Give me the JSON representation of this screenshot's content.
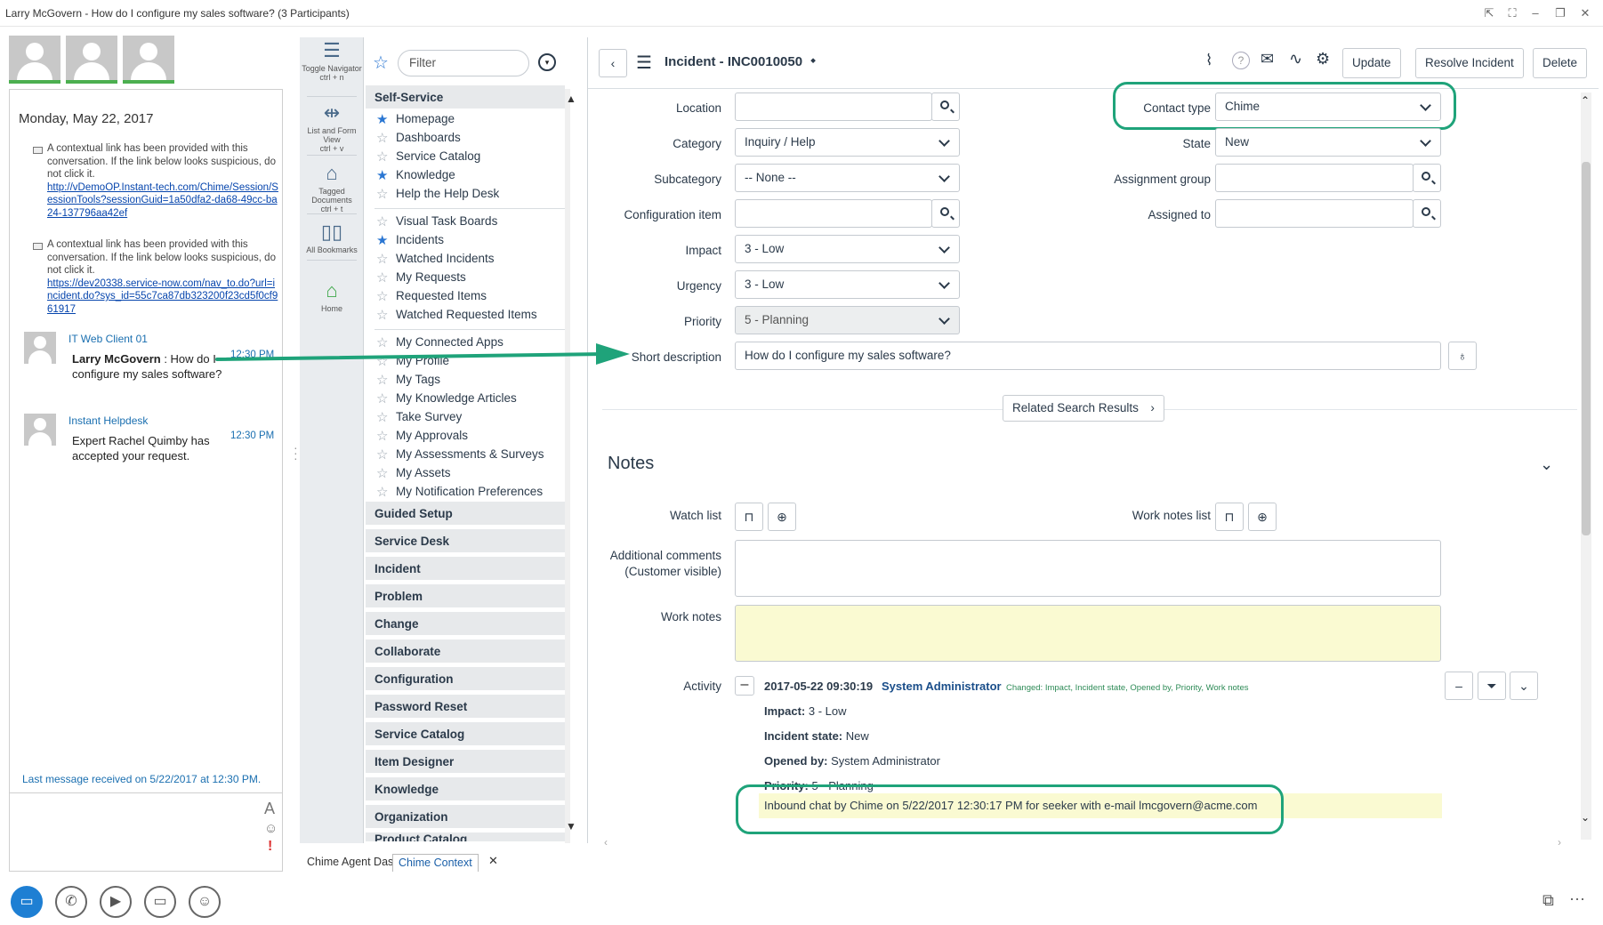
{
  "window": {
    "title": "Larry McGovern - How do I configure my sales software? (3 Participants)"
  },
  "chat": {
    "date": "Monday, May 22, 2017",
    "sys1_text": "A contextual link has been provided with this conversation. If the link below looks suspicious, do not click it.",
    "sys1_link": "http://vDemoOP.Instant-tech.com/Chime/Session/SessionTools?sessionGuid=1a50dfa2-da68-49cc-ba24-137796aa42ef",
    "sys2_text": "A contextual link has been provided with this conversation. If the link below looks suspicious, do not click it.",
    "sys2_link": "https://dev20338.service-now.com/nav_to.do?url=incident.do?sys_id=55c7ca87db323200f23cd5f0cf961917",
    "msg1_sender": "IT Web Client 01",
    "msg1_time": "12:30 PM",
    "msg1_name": "Larry McGovern",
    "msg1_text": " : How do I configure my sales software?",
    "msg2_sender": "Instant Helpdesk",
    "msg2_time": "12:30 PM",
    "msg2_text": "Expert Rachel Quimby has accepted your request.",
    "last_message": "Last message received on 5/22/2017 at 12:30 PM."
  },
  "navstrip": {
    "toggle": "Toggle Navigator",
    "toggle_key": "ctrl + n",
    "listform": "List and Form View",
    "listform_key": "ctrl + v",
    "tagged": "Tagged Documents",
    "tagged_key": "ctrl + t",
    "bookmarks": "All Bookmarks",
    "home": "Home"
  },
  "navmenu": {
    "filter_placeholder": "Filter",
    "selfservice": "Self-Service",
    "items": [
      "Homepage",
      "Dashboards",
      "Service Catalog",
      "Knowledge",
      "Help the Help Desk",
      "Visual Task Boards",
      "Incidents",
      "Watched Incidents",
      "My Requests",
      "Requested Items",
      "Watched Requested Items",
      "My Connected Apps",
      "My Profile",
      "My Tags",
      "My Knowledge Articles",
      "Take Survey",
      "My Approvals",
      "My Assessments & Surveys",
      "My Assets",
      "My Notification Preferences"
    ],
    "sections": [
      "Guided Setup",
      "Service Desk",
      "Incident",
      "Problem",
      "Change",
      "Collaborate",
      "Configuration",
      "Password Reset",
      "Service Catalog",
      "Item Designer",
      "Knowledge",
      "Organization",
      "Product Catalog"
    ]
  },
  "form": {
    "title": "Incident - INC0010050",
    "update": "Update",
    "resolve": "Resolve Incident",
    "delete": "Delete",
    "location_label": "Location",
    "category_label": "Category",
    "category": "Inquiry / Help",
    "subcategory_label": "Subcategory",
    "subcategory": "-- None --",
    "ci_label": "Configuration item",
    "impact_label": "Impact",
    "impact": "3 - Low",
    "urgency_label": "Urgency",
    "urgency": "3 - Low",
    "priority_label": "Priority",
    "priority": "5 - Planning",
    "short_desc_label": "Short description",
    "short_desc": "How do I configure my sales software?",
    "contact_label": "Contact type",
    "contact": "Chime",
    "state_label": "State",
    "state": "New",
    "assign_group_label": "Assignment group",
    "assigned_to_label": "Assigned to",
    "related": "Related Search Results",
    "notes": "Notes",
    "watch_label": "Watch list",
    "worknotes_list_label": "Work notes list",
    "additional_label": "Additional comments",
    "additional_sub": "(Customer visible)",
    "worknotes_label": "Work notes",
    "activity_label": "Activity",
    "act_time": "2017-05-22 09:30:19",
    "act_user": "System Administrator",
    "act_changed": "Changed:  Impact, Incident state, Opened by, Priority, Work notes",
    "impact_k": "Impact:",
    "impact_v": " 3 - Low",
    "state_k": "Incident state:",
    "state_v": " New",
    "opened_k": "Opened by:",
    "opened_v": " System Administrator",
    "priority_k": "Priority:",
    "priority_v": " 5 - Planning",
    "inbound": "Inbound chat by Chime on 5/22/2017 12:30:17 PM for seeker with e-mail lmcgovern@acme.com"
  },
  "tabs": {
    "tab1": "Chime Agent Das",
    "tab2": "Chime Context"
  },
  "colors": {
    "accent_green": "#1fa37a",
    "nav_blue": "#2a76d2"
  }
}
